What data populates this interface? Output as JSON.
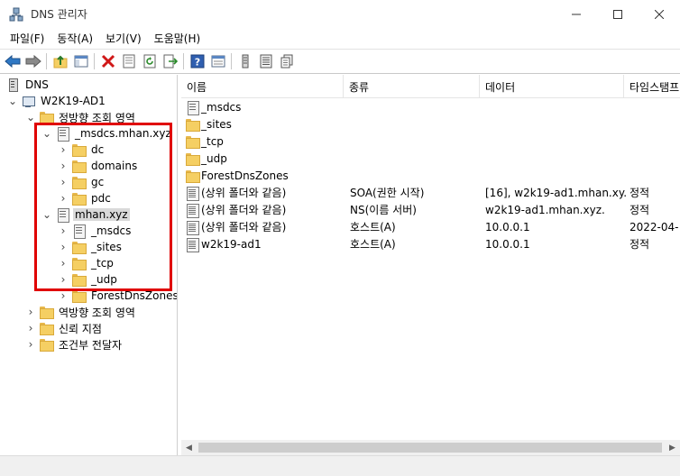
{
  "window": {
    "title": "DNS 관리자",
    "minimize": "—",
    "maximize": "☐",
    "close": "✕"
  },
  "menu": [
    "파일(F)",
    "동작(A)",
    "보기(V)",
    "도움말(H)"
  ],
  "toolbar_icons": [
    "back-arrow-icon",
    "forward-arrow-icon",
    "up-folder-icon",
    "show-tree-icon",
    "delete-icon",
    "properties-icon",
    "refresh-icon",
    "export-icon",
    "help-icon",
    "console-icon",
    "server-icon",
    "list-icon",
    "copy-icon"
  ],
  "tree": {
    "root": "DNS",
    "server": "W2K19-AD1",
    "forward_zones": "정방향 조회 영역",
    "msdcs_zone": "_msdcs.mhan.xyz",
    "msdcs_children": [
      "dc",
      "domains",
      "gc",
      "pdc"
    ],
    "mhan_zone": "mhan.xyz",
    "mhan_children": [
      "_msdcs",
      "_sites",
      "_tcp",
      "_udp",
      "ForestDnsZones"
    ],
    "reverse_zones": "역방향 조회 영역",
    "trust_points": "신뢰 지점",
    "conditional_forwarders": "조건부 전달자"
  },
  "list": {
    "columns": [
      "이름",
      "종류",
      "데이터",
      "타임스탬프"
    ],
    "rows": [
      {
        "icon": "zone-folder",
        "name": "_msdcs",
        "type": "",
        "data": "",
        "timestamp": ""
      },
      {
        "icon": "folder",
        "name": "_sites",
        "type": "",
        "data": "",
        "timestamp": ""
      },
      {
        "icon": "folder",
        "name": "_tcp",
        "type": "",
        "data": "",
        "timestamp": ""
      },
      {
        "icon": "folder",
        "name": "_udp",
        "type": "",
        "data": "",
        "timestamp": ""
      },
      {
        "icon": "folder",
        "name": "ForestDnsZones",
        "type": "",
        "data": "",
        "timestamp": ""
      },
      {
        "icon": "record",
        "name": "(상위 폴더와 같음)",
        "type": "SOA(권한 시작)",
        "data": "[16], w2k19-ad1.mhan.xy...",
        "timestamp": "정적"
      },
      {
        "icon": "record",
        "name": "(상위 폴더와 같음)",
        "type": "NS(이름 서버)",
        "data": "w2k19-ad1.mhan.xyz.",
        "timestamp": "정적"
      },
      {
        "icon": "record",
        "name": "(상위 폴더와 같음)",
        "type": "호스트(A)",
        "data": "10.0.0.1",
        "timestamp": "2022-04-"
      },
      {
        "icon": "record",
        "name": "w2k19-ad1",
        "type": "호스트(A)",
        "data": "10.0.0.1",
        "timestamp": "정적"
      }
    ]
  }
}
